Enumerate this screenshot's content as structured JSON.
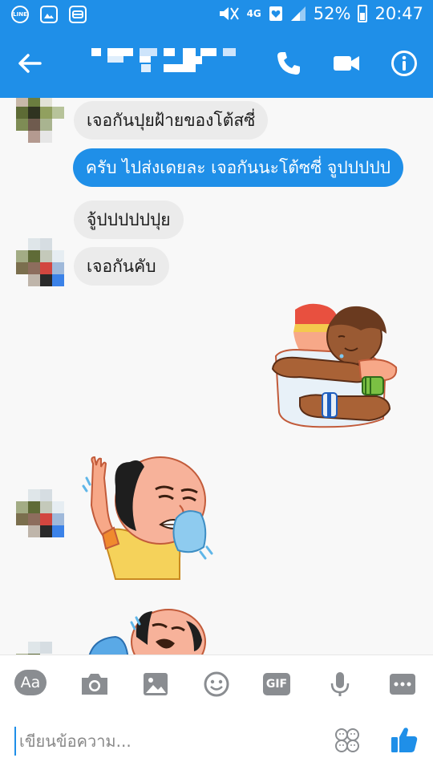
{
  "status_bar": {
    "network": "4G",
    "battery": "52%",
    "time": "20:47"
  },
  "header": {
    "contact_name": ""
  },
  "messages": [
    {
      "side": "in",
      "text": "เจอกันปุยฝ้ายของโต้สซี่"
    },
    {
      "side": "out",
      "text": "ครับ ไปส่งเดยละ เจอกันนะโต้ซซี่ จูปปปปป"
    },
    {
      "side": "in",
      "text": "จู้ปปปปปปุย"
    },
    {
      "side": "in",
      "text": "เจอกันคับ"
    }
  ],
  "stickers": [
    {
      "side": "out",
      "icon": "hug-sticker"
    },
    {
      "side": "in",
      "icon": "crying-man-sticker"
    },
    {
      "side": "in",
      "icon": "crying-man-sticker-2"
    }
  ],
  "composer": {
    "toolbar": {
      "aa_label": "Aa",
      "gif_label": "GIF"
    },
    "placeholder": "เขียนข้อความ..."
  },
  "colors": {
    "brand": "#1f8fe8",
    "incoming_bubble": "#ebebeb"
  }
}
